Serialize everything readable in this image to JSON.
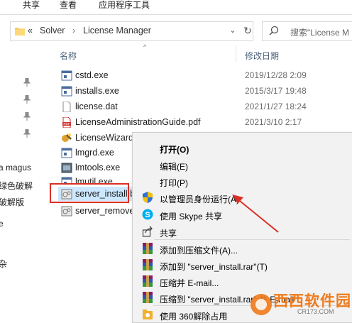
{
  "ribbon": {
    "tabs": [
      "共享",
      "查看",
      "应用程序工具"
    ]
  },
  "address": {
    "separator": "«",
    "crumbs": [
      "Solver",
      "License Manager"
    ],
    "crumb_separator": "›",
    "chevron": "⌄",
    "refresh": "↻"
  },
  "search": {
    "placeholder": "搜索\"License M"
  },
  "nav": {
    "items": [
      "a magus",
      "绿色破解",
      "破解版",
      "e",
      "杂"
    ]
  },
  "columns": {
    "name": "名称",
    "modified": "修改日期",
    "sort_indicator": "^"
  },
  "files": [
    {
      "name": "cstd.exe",
      "date": "2019/12/28 2:09",
      "icon": "exe-icon"
    },
    {
      "name": "installs.exe",
      "date": "2015/3/17 19:48",
      "icon": "exe-icon"
    },
    {
      "name": "license.dat",
      "date": "2021/1/27 18:24",
      "icon": "document-icon"
    },
    {
      "name": "LicenseAdministrationGuide.pdf",
      "date": "2021/3/10 2:17",
      "icon": "pdf-icon"
    },
    {
      "name": "LicenseWizard",
      "date": "",
      "icon": "wizard-icon"
    },
    {
      "name": "lmgrd.exe",
      "date": "",
      "icon": "exe-icon"
    },
    {
      "name": "lmtools.exe",
      "date": "",
      "icon": "tools-icon"
    },
    {
      "name": "lmutil.exe",
      "date": "",
      "icon": "exe-icon"
    },
    {
      "name": "server_install.b",
      "date": "",
      "icon": "batch-icon"
    },
    {
      "name": "server_remove",
      "date": "",
      "icon": "batch-icon"
    }
  ],
  "context_menu": {
    "items": [
      {
        "label": "打开(O)",
        "icon": "",
        "bold": true
      },
      {
        "label": "编辑(E)",
        "icon": ""
      },
      {
        "label": "打印(P)",
        "icon": ""
      },
      {
        "label": "以管理员身份运行(A)",
        "icon": "uac-shield-icon"
      },
      {
        "label": "使用 Skype 共享",
        "icon": "skype-icon"
      },
      {
        "label": "共享",
        "icon": "share-icon"
      },
      {
        "label": "添加到压缩文件(A)...",
        "icon": "winrar-icon"
      },
      {
        "label": "添加到 \"server_install.rar\"(T)",
        "icon": "winrar-icon"
      },
      {
        "label": "压缩并 E-mail...",
        "icon": "winrar-icon"
      },
      {
        "label": "压缩到 \"server_install.rar\" 并 E-mail",
        "icon": "winrar-icon"
      },
      {
        "label": "使用 360解除占用",
        "icon": "360-icon"
      }
    ]
  },
  "watermark": {
    "text": "西西软件园",
    "url": "CR173.COM"
  },
  "colors": {
    "highlight_box": "#d93025",
    "arrow": "#d93025",
    "selection": "#cce8ff",
    "context_bg": "#f2f2f2"
  }
}
